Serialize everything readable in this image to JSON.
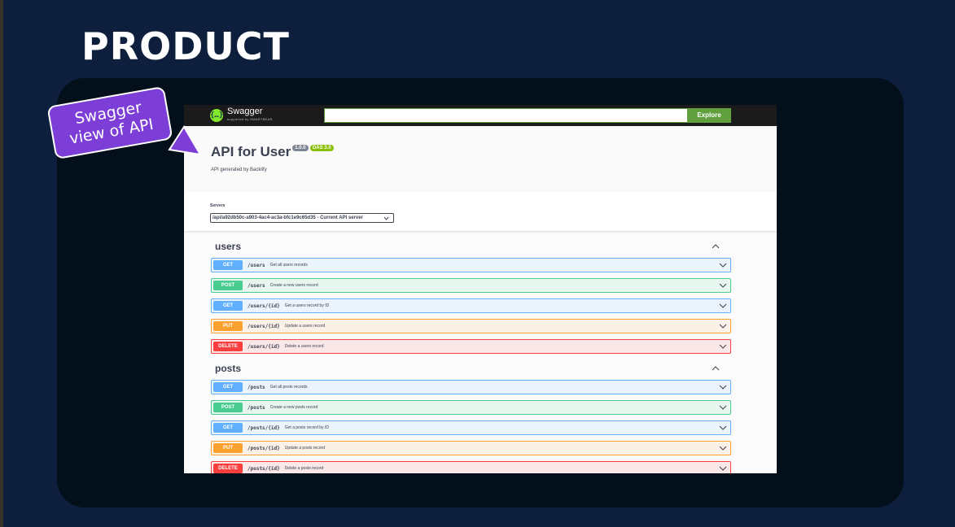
{
  "slide": {
    "title": "PRODUCT"
  },
  "callout": {
    "line1": "Swagger",
    "line2": "view of API",
    "color": "#7d3ed8"
  },
  "topbar": {
    "logo_name": "Swagger",
    "logo_sub": "supported by SMARTBEAR",
    "url_value": "",
    "explore_label": "Explore"
  },
  "info": {
    "title": "API for User",
    "version": "1.0.0",
    "oas": "OAS 3.0",
    "description": "API generated by Backlify"
  },
  "servers": {
    "label": "Servers",
    "selected": "/api/a92db50c-a903-4ac4-ac3a-bfc1e9c65d35 - Current API server"
  },
  "method_colors": {
    "GET": {
      "bg": "#ebf3fb",
      "border": "#61affe"
    },
    "POST": {
      "bg": "#e8f6f0",
      "border": "#49cc90"
    },
    "PUT": {
      "bg": "#fbf1e6",
      "border": "#fca130"
    },
    "DELETE": {
      "bg": "#fae7e7",
      "border": "#f93e3e"
    }
  },
  "tags": [
    {
      "name": "users",
      "operations": [
        {
          "method": "GET",
          "path": "/users",
          "summary": "Get all users records"
        },
        {
          "method": "POST",
          "path": "/users",
          "summary": "Create a new users record"
        },
        {
          "method": "GET",
          "path": "/users/{id}",
          "summary": "Get a users record by ID"
        },
        {
          "method": "PUT",
          "path": "/users/{id}",
          "summary": "Update a users record"
        },
        {
          "method": "DELETE",
          "path": "/users/{id}",
          "summary": "Delete a users record"
        }
      ]
    },
    {
      "name": "posts",
      "operations": [
        {
          "method": "GET",
          "path": "/posts",
          "summary": "Get all posts records"
        },
        {
          "method": "POST",
          "path": "/posts",
          "summary": "Create a new posts record"
        },
        {
          "method": "GET",
          "path": "/posts/{id}",
          "summary": "Get a posts record by ID"
        },
        {
          "method": "PUT",
          "path": "/posts/{id}",
          "summary": "Update a posts record"
        },
        {
          "method": "DELETE",
          "path": "/posts/{id}",
          "summary": "Delete a posts record"
        }
      ]
    }
  ]
}
